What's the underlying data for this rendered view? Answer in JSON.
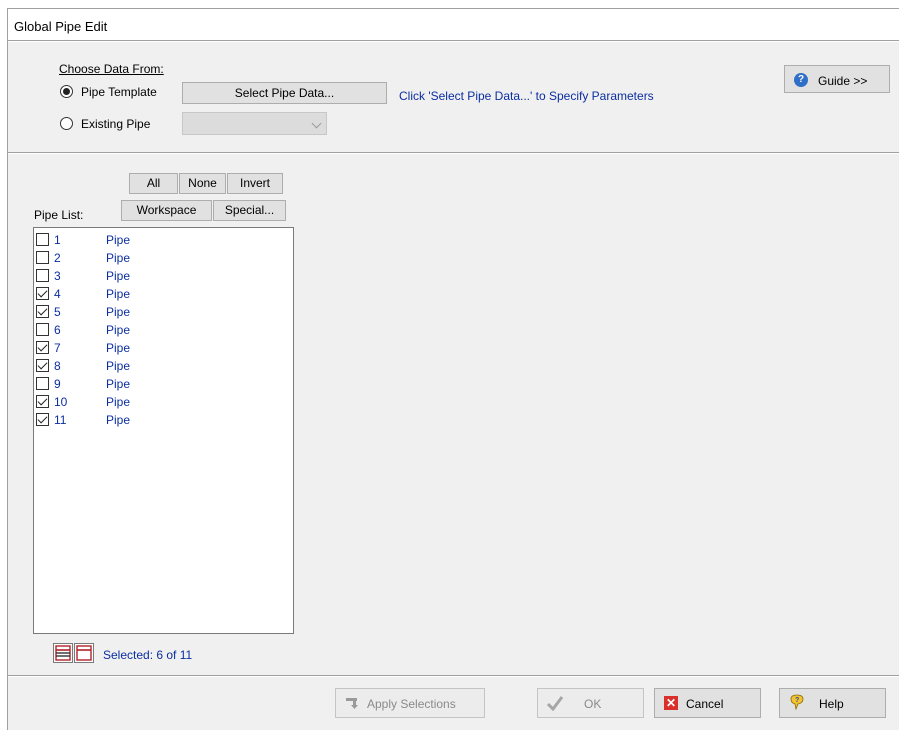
{
  "window": {
    "title": "Global Pipe Edit"
  },
  "choose_data": {
    "heading": "Choose Data From:",
    "pipe_template_label": "Pipe Template",
    "existing_pipe_label": "Existing Pipe",
    "select_button_label": "Select Pipe Data...",
    "hint": "Click 'Select Pipe Data...' to Specify Parameters",
    "existing_pipe_value": ""
  },
  "guide_button_label": "Guide >>",
  "selection_buttons": {
    "all": "All",
    "none": "None",
    "invert": "Invert",
    "workspace": "Workspace",
    "special": "Special..."
  },
  "pipe_list": {
    "label": "Pipe List:",
    "items": [
      {
        "id": "1",
        "name": "Pipe",
        "checked": false
      },
      {
        "id": "2",
        "name": "Pipe",
        "checked": false
      },
      {
        "id": "3",
        "name": "Pipe",
        "checked": false
      },
      {
        "id": "4",
        "name": "Pipe",
        "checked": true
      },
      {
        "id": "5",
        "name": "Pipe",
        "checked": true
      },
      {
        "id": "6",
        "name": "Pipe",
        "checked": false
      },
      {
        "id": "7",
        "name": "Pipe",
        "checked": true
      },
      {
        "id": "8",
        "name": "Pipe",
        "checked": true
      },
      {
        "id": "9",
        "name": "Pipe",
        "checked": false
      },
      {
        "id": "10",
        "name": "Pipe",
        "checked": true
      },
      {
        "id": "11",
        "name": "Pipe",
        "checked": true
      }
    ]
  },
  "selected_status": "Selected: 6 of 11",
  "footer": {
    "apply_label": "Apply Selections",
    "ok_label": "OK",
    "cancel_label": "Cancel",
    "help_label": "Help"
  },
  "colors": {
    "link_blue": "#0b2ea0",
    "dialog_bg": "#f0f0f0",
    "cancel_red": "#d9302c",
    "help_yellow": "#f2c230"
  }
}
